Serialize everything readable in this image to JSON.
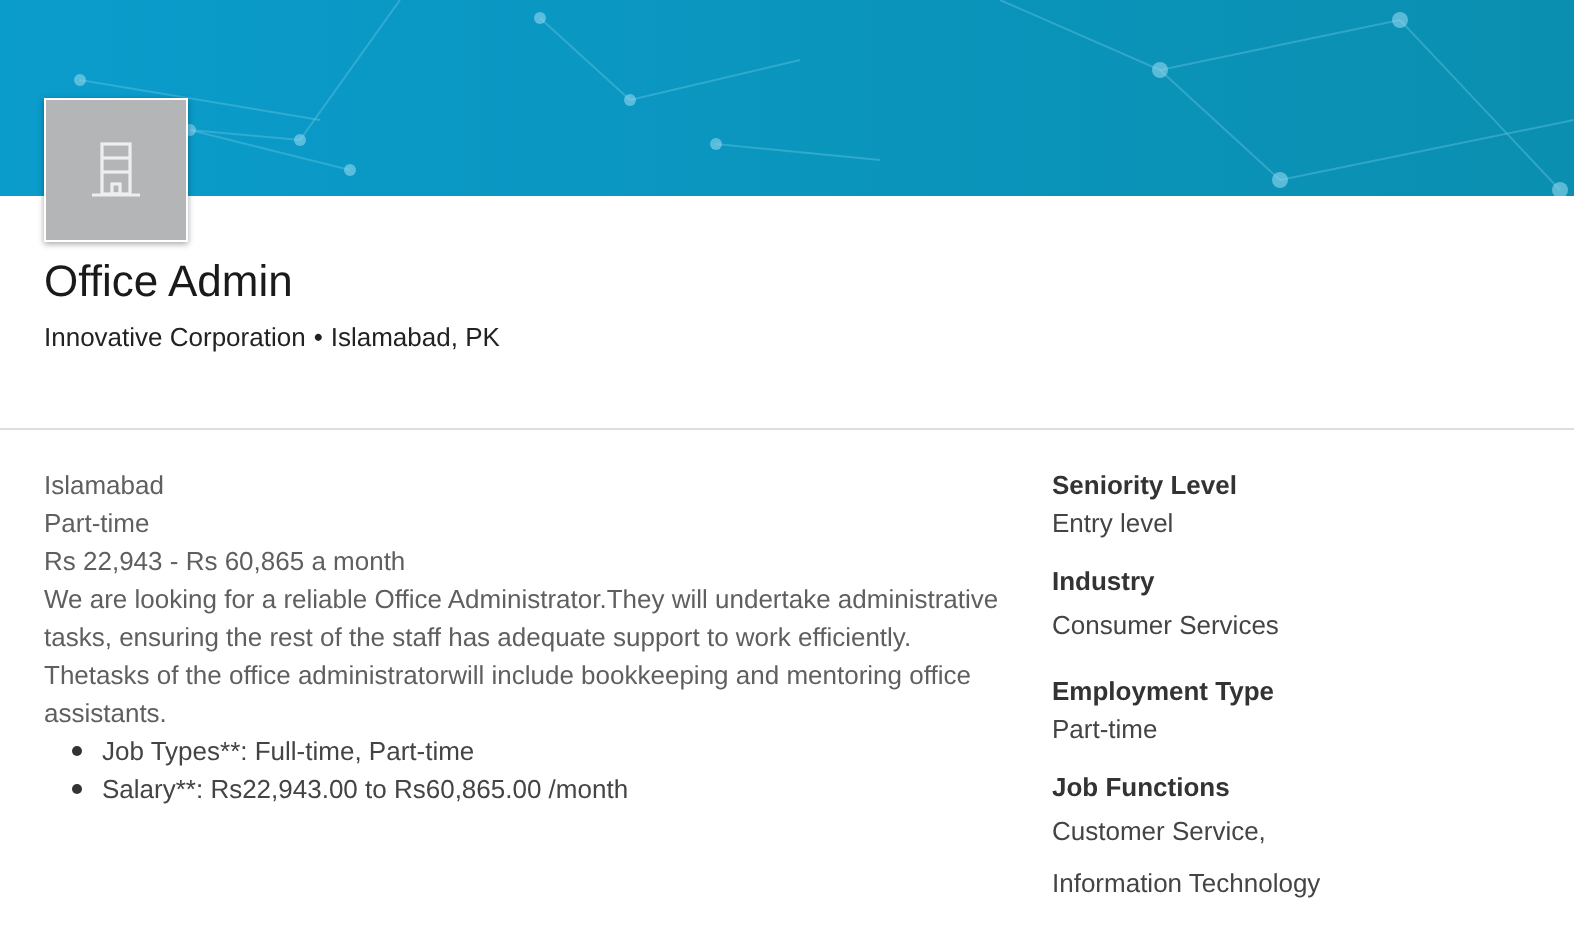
{
  "job": {
    "title": "Office Admin",
    "company": "Innovative Corporation",
    "separator": "•",
    "location": "Islamabad, PK"
  },
  "description": {
    "lines": [
      "Islamabad",
      "Part-time",
      "Rs 22,943 - Rs 60,865 a month"
    ],
    "paragraph": "We are looking for a reliable Office Administrator.They will undertake administrative tasks, ensuring the rest of the staff has adequate support to work efficiently. Thetasks of the office administratorwill include bookkeeping and mentoring office assistants.",
    "bullets": [
      "Job Types**: Full-time, Part-time",
      "Salary**: Rs22,943.00 to Rs60,865.00 /month"
    ]
  },
  "criteria": [
    {
      "heading": "Seniority Level",
      "values": [
        "Entry level"
      ]
    },
    {
      "heading": "Industry",
      "values": [
        "Consumer Services"
      ]
    },
    {
      "heading": "Employment Type",
      "values": [
        "Part-time"
      ]
    },
    {
      "heading": "Job Functions",
      "values": [
        "Customer Service,",
        "Information Technology"
      ]
    }
  ]
}
